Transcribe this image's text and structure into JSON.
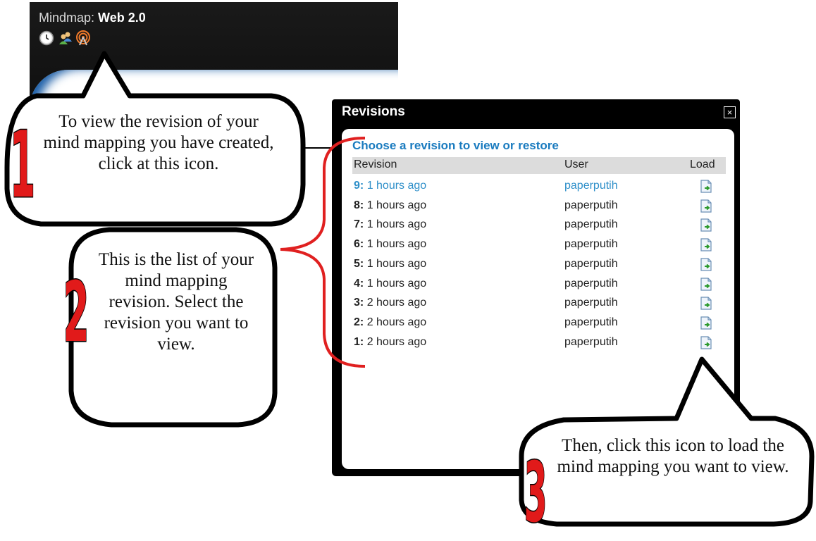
{
  "app": {
    "title_prefix": "Mindmap:",
    "title_name": "Web 2.0",
    "toolbar_icons": [
      "clock-icon",
      "users-icon",
      "revisions-icon"
    ]
  },
  "revisions": {
    "window_title": "Revisions",
    "close_glyph": "×",
    "heading": "Choose a revision to view or restore",
    "columns": {
      "revision": "Revision",
      "user": "User",
      "load": "Load"
    },
    "rows": [
      {
        "num": "9:",
        "time": "1 hours ago",
        "user": "paperputih",
        "selected": true
      },
      {
        "num": "8:",
        "time": "1 hours ago",
        "user": "paperputih"
      },
      {
        "num": "7:",
        "time": "1 hours ago",
        "user": "paperputih"
      },
      {
        "num": "6:",
        "time": "1 hours ago",
        "user": "paperputih"
      },
      {
        "num": "5:",
        "time": "1 hours ago",
        "user": "paperputih"
      },
      {
        "num": "4:",
        "time": "1 hours ago",
        "user": "paperputih"
      },
      {
        "num": "3:",
        "time": "2 hours ago",
        "user": "paperputih"
      },
      {
        "num": "2:",
        "time": "2 hours ago",
        "user": "paperputih"
      },
      {
        "num": "1:",
        "time": "2 hours ago",
        "user": "paperputih"
      }
    ]
  },
  "callouts": {
    "step1": {
      "number": "1",
      "text": "To view the revision of your mind mapping you have created, click at this icon."
    },
    "step2": {
      "number": "2",
      "text": "This is the list of your mind mapping revision. Select the revision you want to view."
    },
    "step3": {
      "number": "3",
      "text": "Then, click this icon to load the mind mapping you want to view."
    }
  },
  "colors": {
    "accent_blue": "#1a7bbf",
    "step_number_red": "#e11a1a",
    "bracket_red": "#e02020"
  }
}
